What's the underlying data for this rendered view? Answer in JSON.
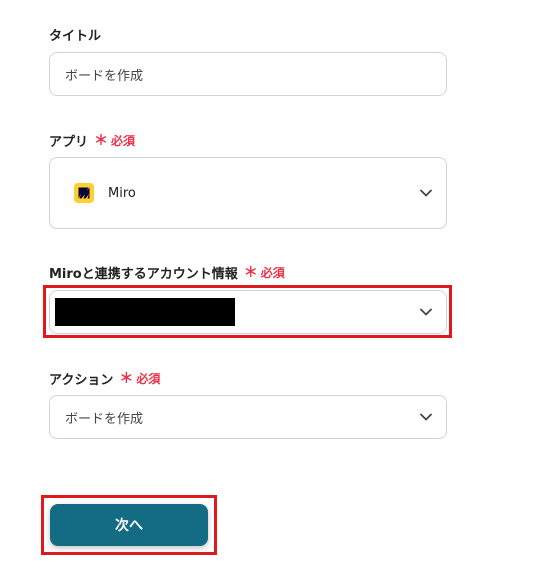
{
  "title_field": {
    "label": "タイトル",
    "value": "ボードを作成"
  },
  "app_field": {
    "label": "アプリ",
    "required_mark": "＊",
    "required_text": "必須",
    "value": "Miro",
    "icon": "miro-logo-icon"
  },
  "account_field": {
    "label": "Miroと連携するアカウント情報",
    "required_mark": "＊",
    "required_text": "必須",
    "value": ""
  },
  "action_field": {
    "label": "アクション",
    "required_mark": "＊",
    "required_text": "必須",
    "value": "ボードを作成"
  },
  "next_button": {
    "label": "次へ"
  },
  "colors": {
    "accent": "#146b84",
    "required": "#e8334a",
    "highlight": "#e0191f",
    "miro_yellow": "#ffd02f"
  }
}
